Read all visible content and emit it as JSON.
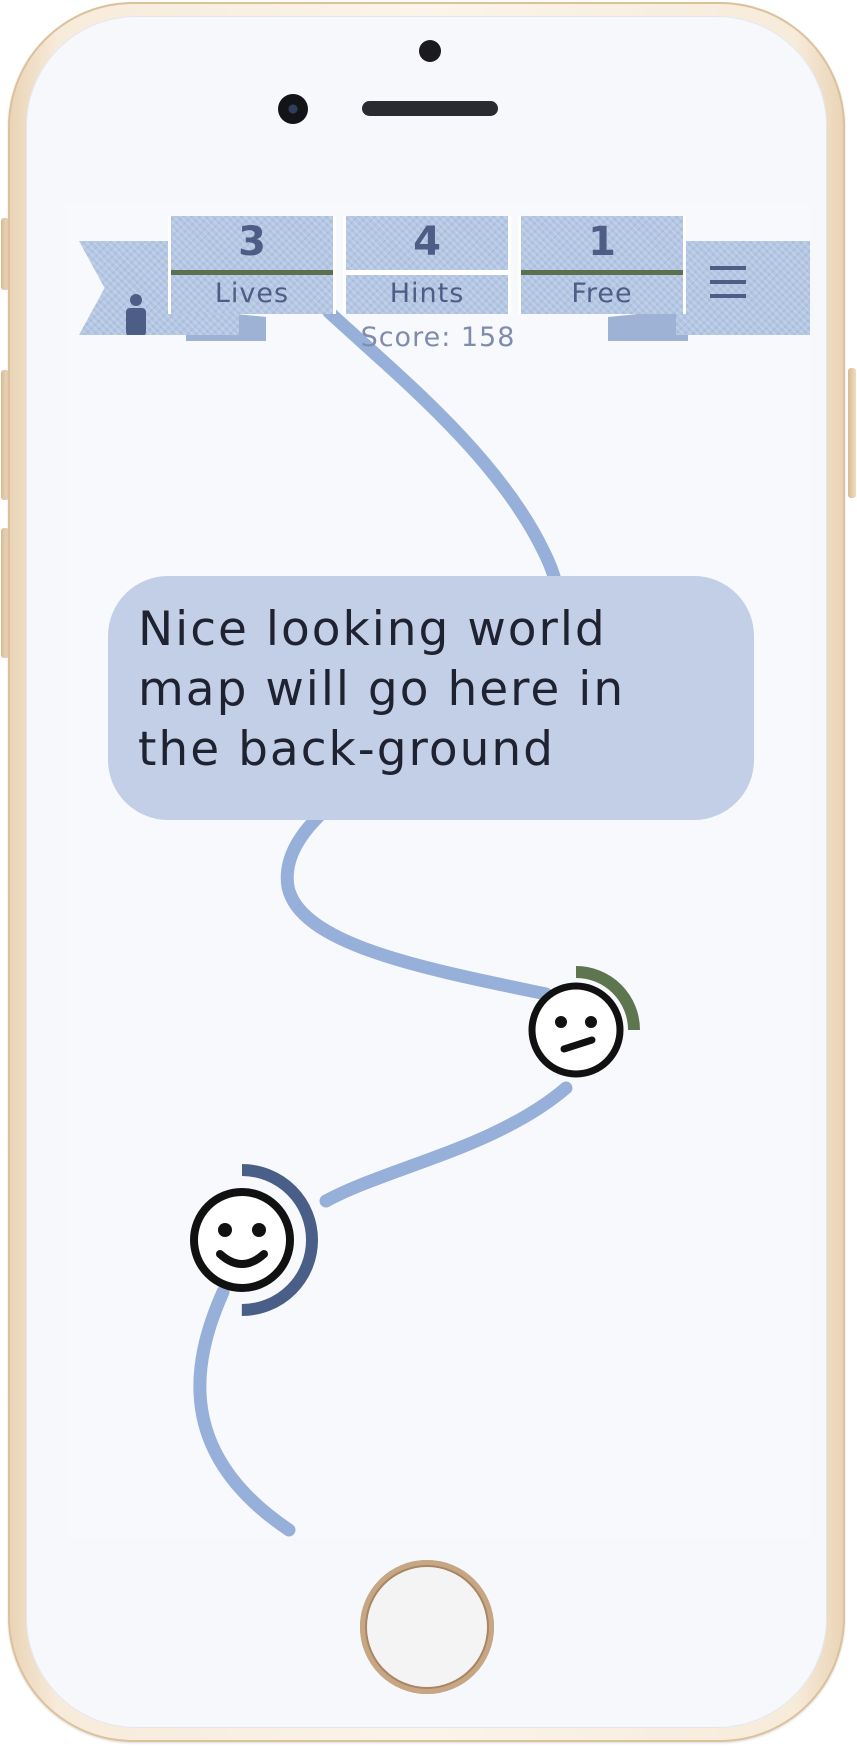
{
  "hud": {
    "lives": {
      "value": "3",
      "label": "Lives",
      "accent": "#5c6f4f"
    },
    "hints": {
      "value": "4",
      "label": "Hints",
      "accent": "#ffffff"
    },
    "free": {
      "value": "1",
      "label": "Free",
      "accent": "#5c6f4f"
    },
    "profile_icon": "person-icon",
    "menu_icon": "hamburger-menu-icon"
  },
  "score": {
    "text": "Score: 158"
  },
  "map_placeholder": {
    "text": "Nice looking world map will go here in the back-ground"
  },
  "levels": [
    {
      "name": "neutral-face",
      "progress": 0.25,
      "ring_color": "#5d7650"
    },
    {
      "name": "happy-face",
      "progress": 0.5,
      "ring_color": "#4a5f88"
    }
  ],
  "colors": {
    "path": "#97b0da",
    "ribbon": "#b3c6e3",
    "text_dark": "#4d5e86"
  }
}
